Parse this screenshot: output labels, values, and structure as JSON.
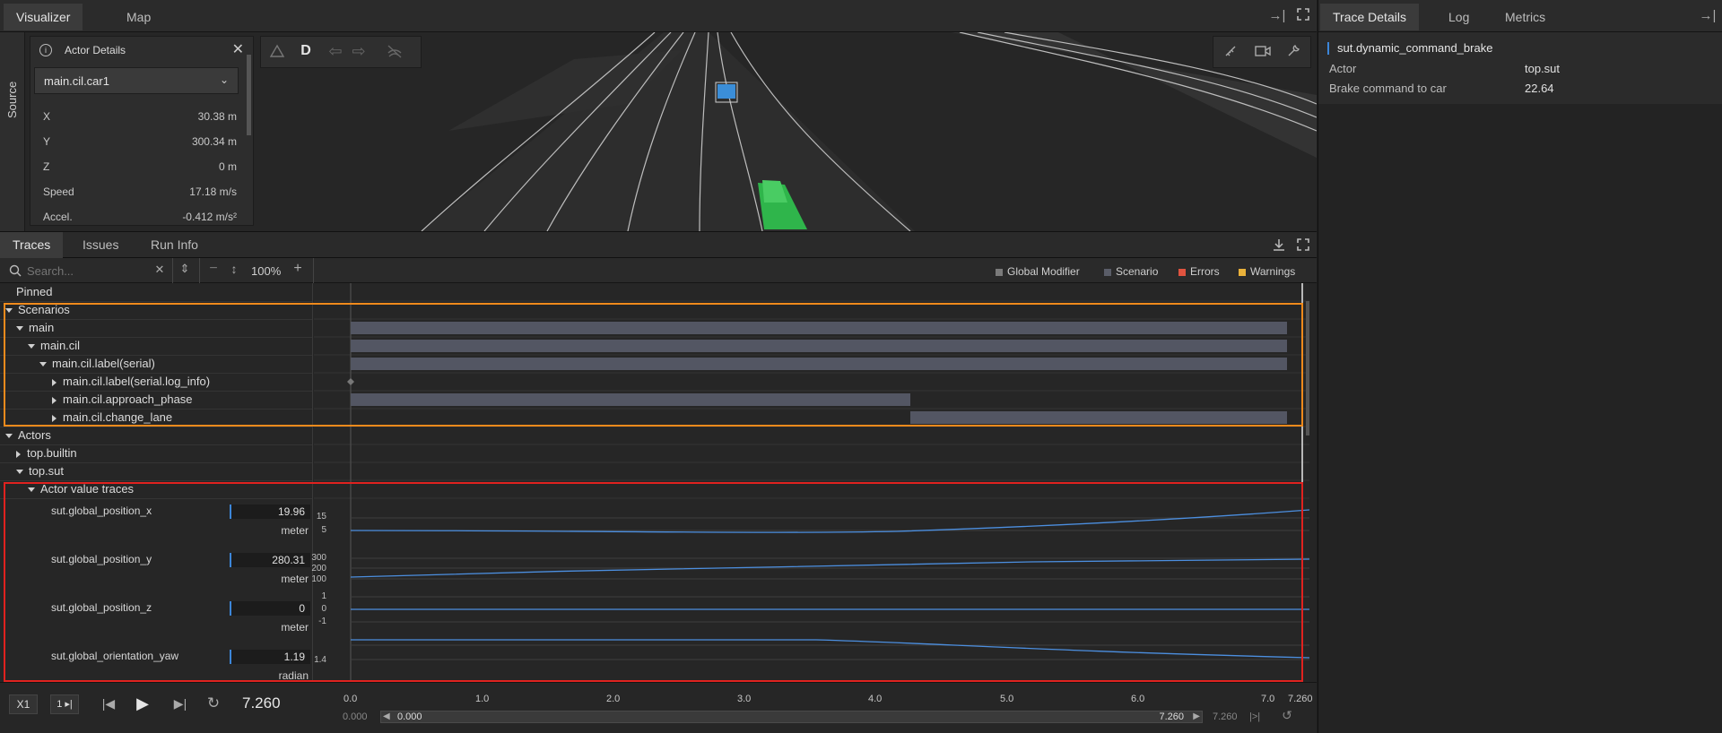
{
  "top_tabs": {
    "visualizer": "Visualizer",
    "map": "Map"
  },
  "source_rail": {
    "label": "Source"
  },
  "actor_panel": {
    "title": "Actor Details",
    "selected_actor": "main.cil.car1",
    "rows": [
      {
        "label": "X",
        "value": "30.38 m"
      },
      {
        "label": "Y",
        "value": "300.34 m"
      },
      {
        "label": "Z",
        "value": "0 m"
      },
      {
        "label": "Speed",
        "value": "17.18 m/s"
      },
      {
        "label": "Accel.",
        "value": "-0.412 m/s²"
      }
    ]
  },
  "viz_toolbar": {
    "mode_label": "D"
  },
  "right_panel": {
    "tabs": [
      "Trace Details",
      "Log",
      "Metrics"
    ],
    "trace_title": "sut.dynamic_command_brake",
    "details": [
      {
        "label": "Actor",
        "value": "top.sut"
      },
      {
        "label": "Brake command to car",
        "value": "22.64"
      }
    ]
  },
  "bottom_tabs": {
    "traces": "Traces",
    "issues": "Issues",
    "run_info": "Run Info"
  },
  "search": {
    "placeholder": "Search..."
  },
  "zoom": {
    "value": "100%"
  },
  "legend": [
    {
      "label": "Global Modifier",
      "color": "#7a7a7a"
    },
    {
      "label": "Scenario",
      "color": "#5a5d68"
    },
    {
      "label": "Errors",
      "color": "#e0533f"
    },
    {
      "label": "Warnings",
      "color": "#e9b13a"
    }
  ],
  "tree": {
    "pinned": "Pinned",
    "scenarios": "Scenarios",
    "main": "main",
    "main_cil": "main.cil",
    "label_serial": "main.cil.label(serial)",
    "label_log_info": "main.cil.label(serial.log_info)",
    "approach": "main.cil.approach_phase",
    "change_lane": "main.cil.change_lane",
    "actors": "Actors",
    "builtin": "top.builtin",
    "sut": "top.sut",
    "actor_value_traces": "Actor value traces"
  },
  "traces": [
    {
      "name": "sut.global_position_x",
      "value": "19.96",
      "unit": "meter",
      "ticks": [
        "15",
        "5"
      ]
    },
    {
      "name": "sut.global_position_y",
      "value": "280.31",
      "unit": "meter",
      "ticks": [
        "300",
        "200",
        "100"
      ]
    },
    {
      "name": "sut.global_position_z",
      "value": "0",
      "unit": "meter",
      "ticks": [
        "1",
        "0",
        "-1"
      ]
    },
    {
      "name": "sut.global_orientation_yaw",
      "value": "1.19",
      "unit": "radian",
      "ticks": [
        "1.4"
      ]
    }
  ],
  "playback": {
    "speed": "X1",
    "step": "1 ▸|",
    "current_time": "7.260",
    "range_start_outer": "0.000",
    "range_start": "0.000",
    "range_end": "7.260",
    "range_end_outer": "7.260",
    "loop_label": "|>|"
  },
  "time_axis": {
    "ticks": [
      "0.0",
      "1.0",
      "2.0",
      "3.0",
      "4.0",
      "5.0",
      "6.0",
      "7.0"
    ],
    "end_label": "7.260"
  }
}
